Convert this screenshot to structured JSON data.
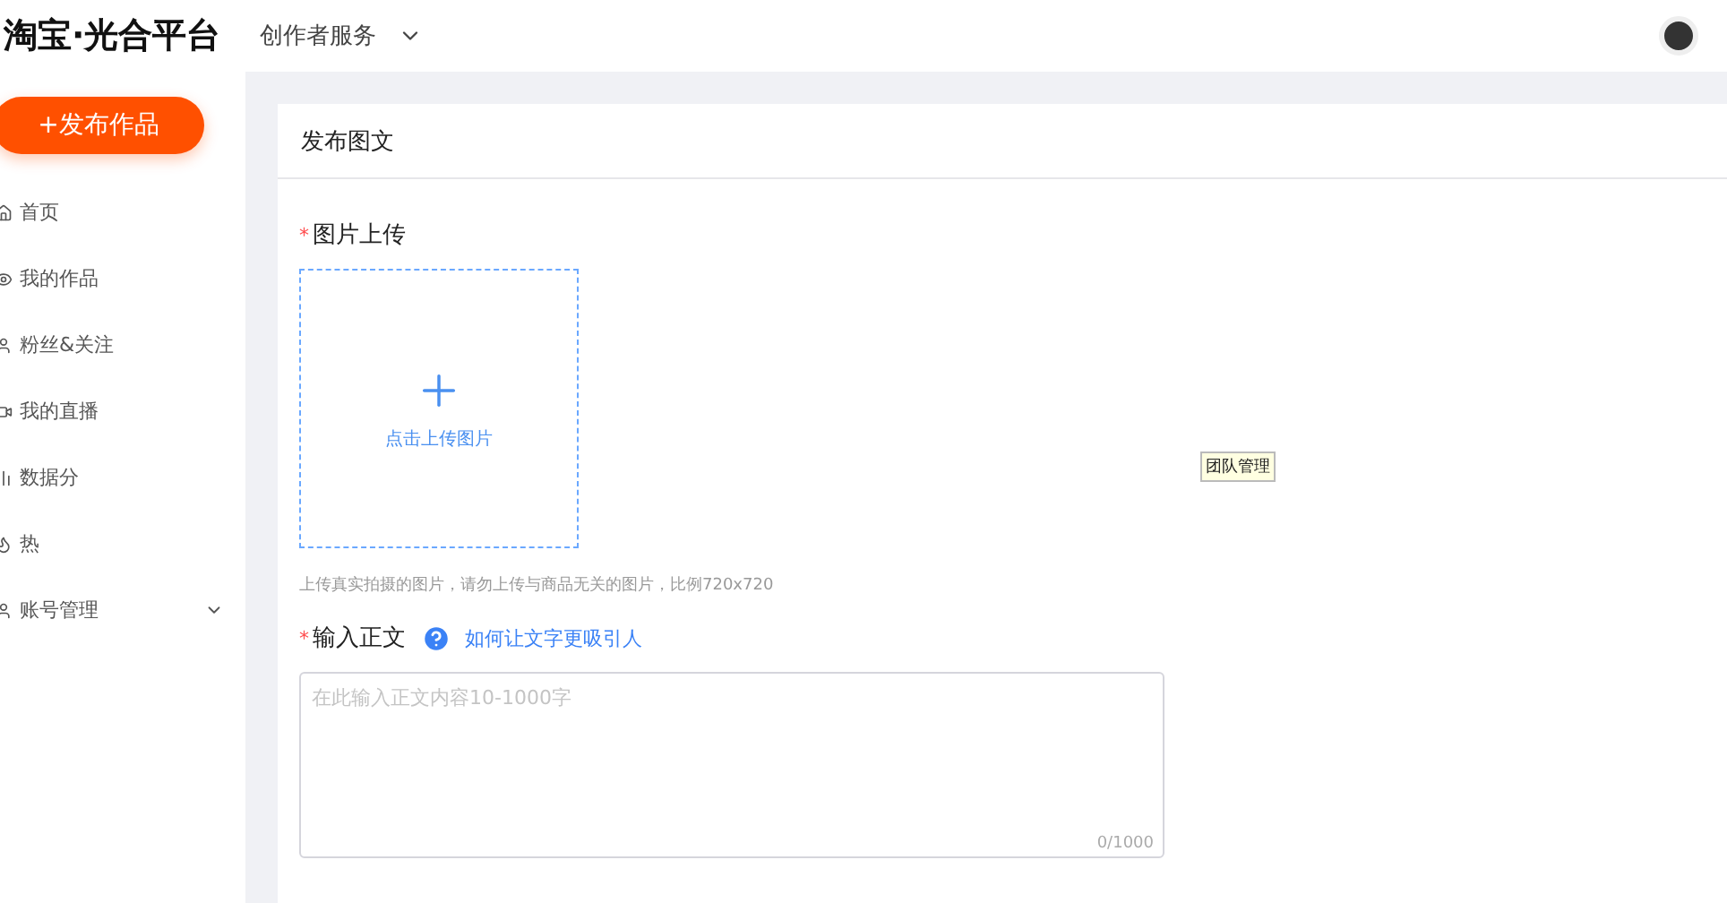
{
  "header": {
    "logo": "淘宝·光合平台",
    "menu": "创作者服务"
  },
  "publish_button": "+发布作品",
  "sidebar": {
    "items": [
      {
        "label": "首页"
      },
      {
        "label": "我的作品"
      },
      {
        "label": "粉丝&关注"
      },
      {
        "label": "我的直播"
      },
      {
        "label": "数据分"
      },
      {
        "label": "热"
      },
      {
        "label": "账号管理",
        "expandable": true
      }
    ]
  },
  "card": {
    "title": "发布图文",
    "upload": {
      "label": "图片上传",
      "required_mark": "*",
      "button": "点击上传图片",
      "hint": "上传真实拍摄的图片，请勿上传与商品无关的图片，比例720x720"
    },
    "body": {
      "label": "输入正文",
      "required_mark": "*",
      "help_link": "如何让文字更吸引人",
      "placeholder": "在此输入正文内容10-1000字",
      "counter": "0/1000"
    }
  },
  "tooltip": "团队管理"
}
